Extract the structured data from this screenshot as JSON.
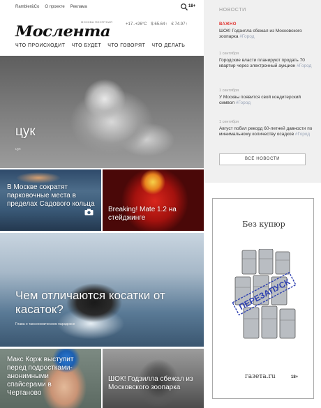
{
  "topbar": {
    "links": [
      "Rambler&Co",
      "О проекте",
      "Реклама"
    ],
    "age": "18+"
  },
  "logo": {
    "text": "Мослента",
    "tagline": "МОСКВА ПОНЯТНАЯ"
  },
  "weather": {
    "temp": "+17..+26°C",
    "usd": "$ 65.64↑",
    "eur": "€ 74.97↑"
  },
  "nav": [
    "ЧТО ПРОИСХОДИТ",
    "ЧТО БУДЕТ",
    "ЧТО ГОВОРЯТ",
    "ЧТО ДЕЛАТЬ"
  ],
  "cards": {
    "hero": {
      "title": "цук",
      "sub": "цук"
    },
    "moscow": {
      "title": "В Москве сократят парковочные места в пределах Садового кольца"
    },
    "flash": {
      "title": "Breaking! Mate 1.2 на стейджинге"
    },
    "orca": {
      "title": "Чем отличаются косатки от касаток?",
      "sub": "Глава о таксономическом парадоксе"
    },
    "korzh": {
      "title": "Макс Корж выступит перед подростками-анонимными спайсерами в Чертаново"
    },
    "godzilla": {
      "title": "ШОК! Годзилла сбежал из Московского зоопарка"
    }
  },
  "sidebar": {
    "heading": "НОВОСТИ",
    "important_label": "ВАЖНО",
    "items": [
      {
        "date": "",
        "text": "ШОК! Годзилла сбежал из Московского зоопарка",
        "tag": "#Город"
      },
      {
        "date": "1 сентября",
        "text": "Городские власти планируют продать 70 квартир через электронный аукцион",
        "tag": "#Город"
      },
      {
        "date": "1 сентября",
        "text": "У Москвы появится свой кондитерский символ",
        "tag": "#Город"
      },
      {
        "date": "1 сентября",
        "text": "Август побил рекорд 60-летней давности по минимальному количеству осадков",
        "tag": "#Город"
      }
    ],
    "all_news": "ВСЕ НОВОСТИ"
  },
  "ad": {
    "title": "Без купюр",
    "stamp": "ПЕРЕЗАПУСК",
    "brand": "газета.ru",
    "age": "18+"
  },
  "colors": {
    "important": "#e0322e",
    "tag": "#9aa5b8",
    "sidebar_bg": "#f0f0f0"
  }
}
